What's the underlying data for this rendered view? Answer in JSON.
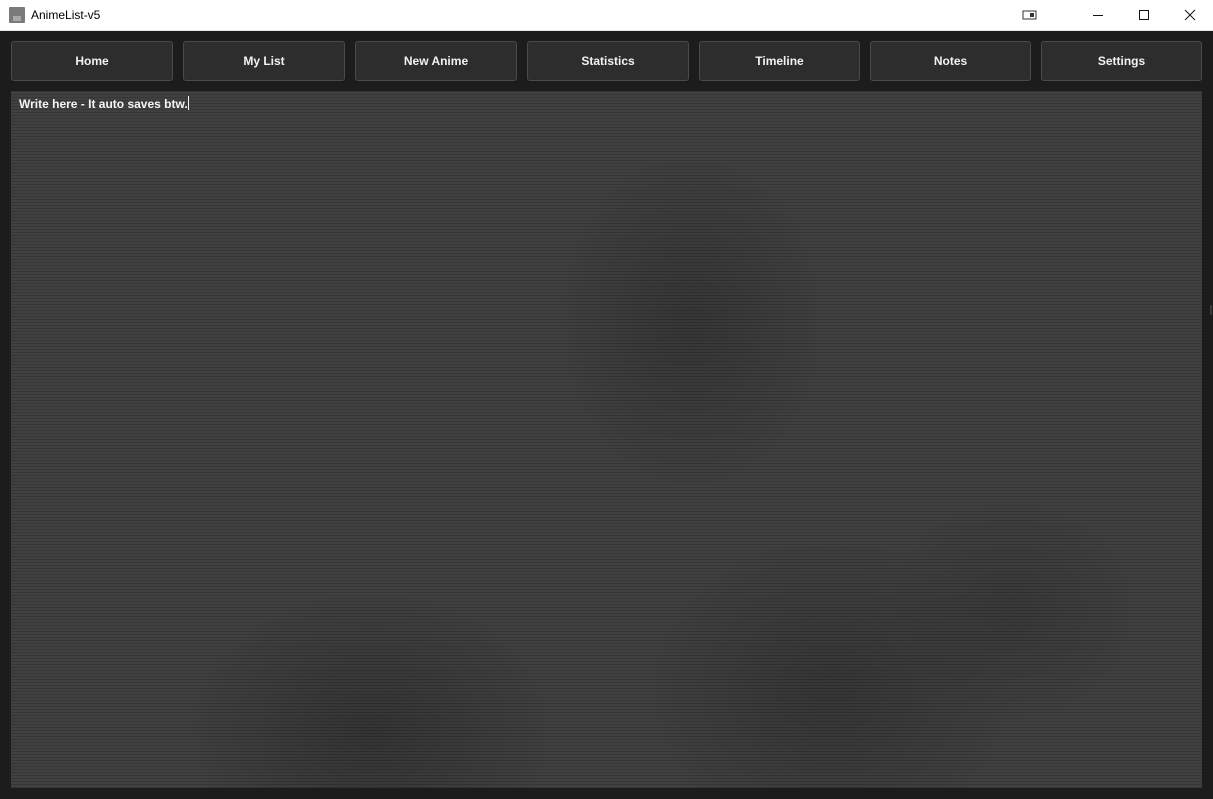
{
  "window": {
    "title": "AnimeList-v5",
    "icons": {
      "app": "app-icon",
      "extra": "window-snap-icon",
      "minimize": "minimize-icon",
      "maximize": "maximize-icon",
      "close": "close-icon"
    }
  },
  "nav": {
    "items": [
      {
        "label": "Home"
      },
      {
        "label": "My List"
      },
      {
        "label": "New Anime"
      },
      {
        "label": "Statistics"
      },
      {
        "label": "Timeline"
      },
      {
        "label": "Notes"
      },
      {
        "label": "Settings"
      }
    ]
  },
  "notes": {
    "value": "Write here - It auto saves btw."
  },
  "colors": {
    "background": "#1c1c1c",
    "button": "#2d2d2d",
    "button_border": "#4a4a4a",
    "text": "#f2f2f2",
    "notes_background": "#3c3c3c"
  }
}
